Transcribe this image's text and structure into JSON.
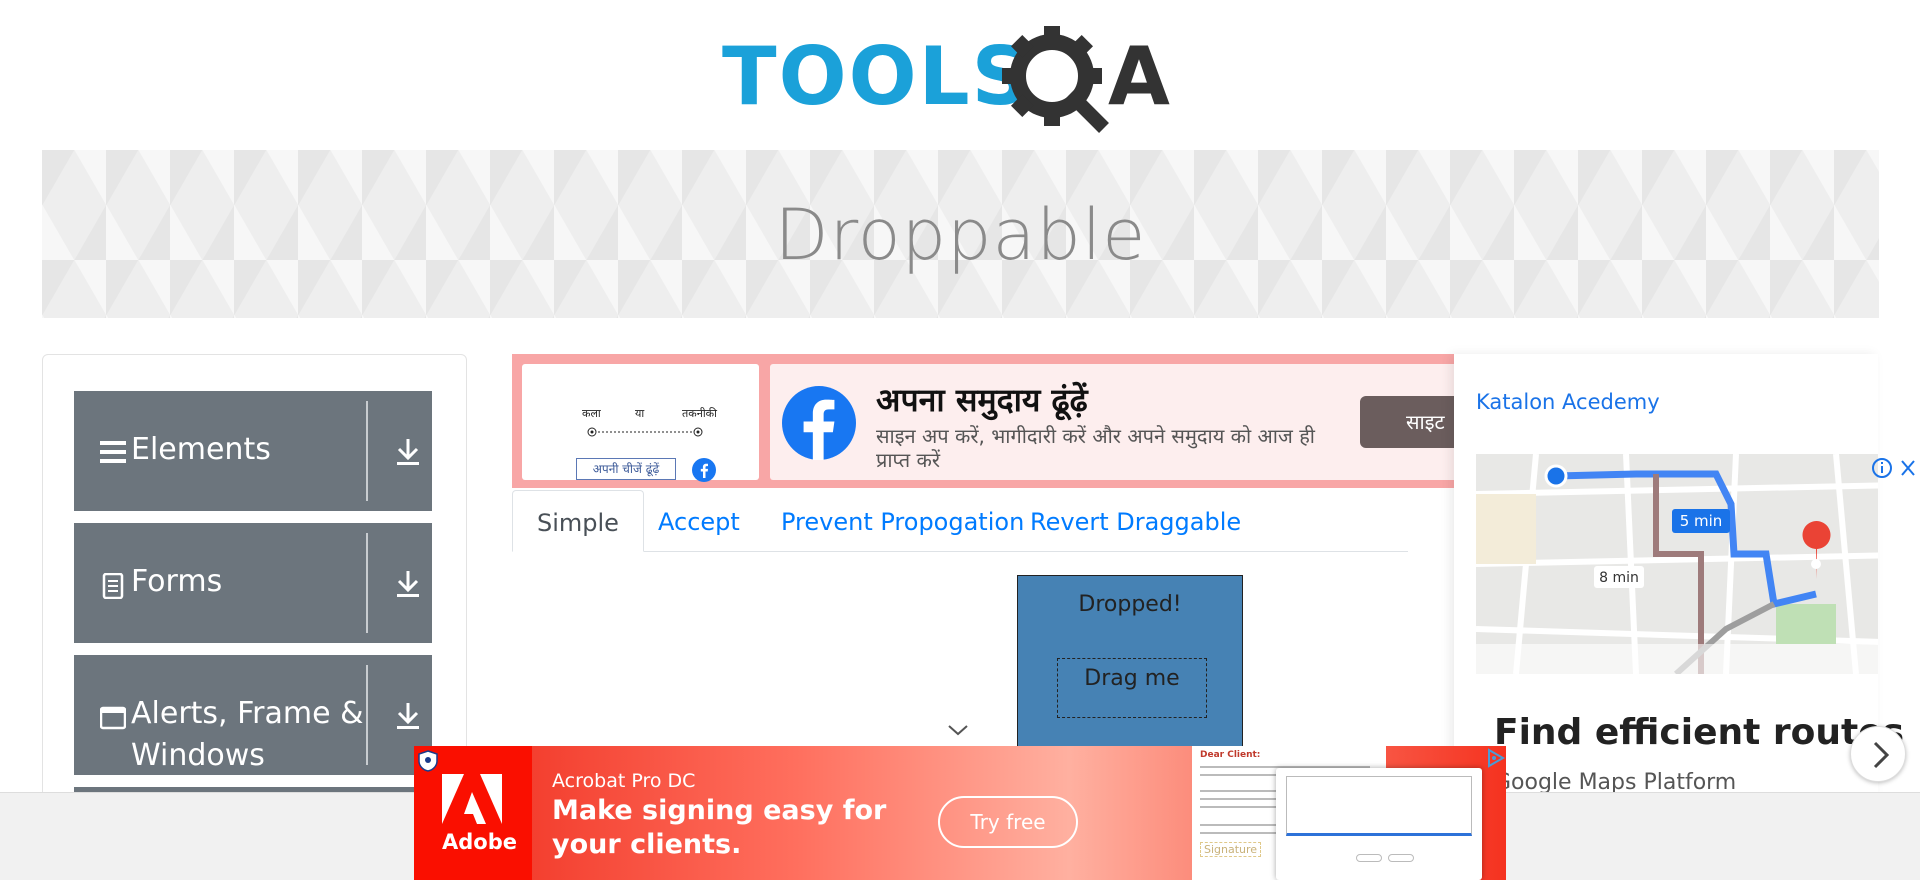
{
  "logo": {
    "alt": "TOOLSQA",
    "text_left": "TOOLS",
    "text_right": "A",
    "colors": {
      "blue": "#1ba1d9",
      "dark": "#333333"
    }
  },
  "banner": {
    "title": "Droppable"
  },
  "sidebar": {
    "groups": [
      {
        "label": "Elements",
        "icon": "hamburger-icon"
      },
      {
        "label": "Forms",
        "icon": "document-icon"
      },
      {
        "label": "Alerts, Frame &",
        "label2": "Windows",
        "icon": "window-icon"
      }
    ],
    "color": "#6c757d"
  },
  "fb_ad": {
    "left_labels": [
      "कला",
      "या",
      "तकनीकी"
    ],
    "left_button": "अपनी चीजें ढूंढ़ें",
    "title": "अपना समुदाय ढूंढ़ें",
    "subtitle": "साइन अप करें, भागीदारी करें और अपने समुदाय को आज ही प्राप्त करें",
    "cta": "साइट"
  },
  "tabs": [
    {
      "label": "Simple",
      "active": true
    },
    {
      "label": "Accept",
      "active": false
    },
    {
      "label": "Prevent Propogation",
      "active": false
    },
    {
      "label": "Revert Draggable",
      "active": false
    }
  ],
  "drop": {
    "target_text": "Dropped!",
    "draggable_text": "Drag me",
    "color": "#4682b4"
  },
  "right_ad": {
    "link": "Katalon Acedemy",
    "map_labels": [
      "5 min",
      "8 min"
    ],
    "headline": "Find efficient routes",
    "sub": "Google Maps Platform"
  },
  "adobe_ad": {
    "brand": "Adobe",
    "product": "Acrobat Pro DC",
    "headline": "Make signing easy for you.",
    "headline_line1": "Make signing easy for",
    "headline_line2": "your clients.",
    "cta": "Try free",
    "doc_title": "Dear Client:",
    "signature_label": "Signature"
  }
}
